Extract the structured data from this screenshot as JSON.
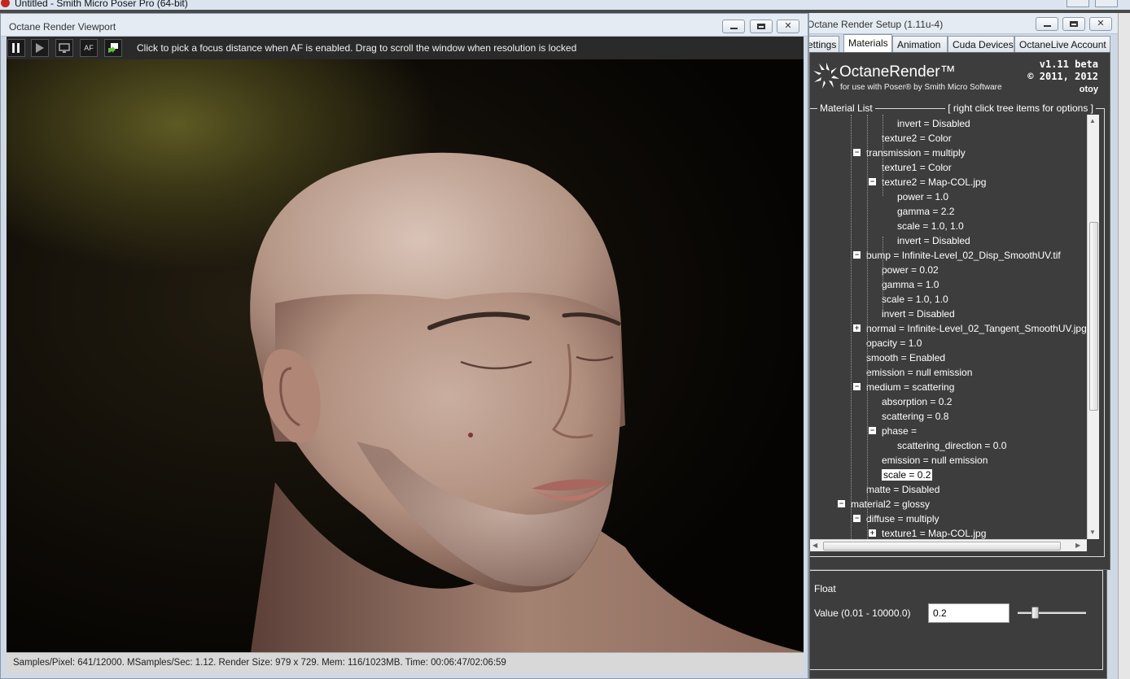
{
  "poser": {
    "title": "Untitled - Smith Micro Poser Pro  (64-bit)"
  },
  "viewport": {
    "title": "Octane Render Viewport",
    "hint": "Click to pick a focus distance when AF is enabled.  Drag to scroll the window when resolution is locked",
    "toolbar": {
      "af_label": "AF"
    },
    "status": "Samples/Pixel: 641/12000. MSamples/Sec: 1.12. Render Size: 979 x 729. Mem: 116/1023MB. Time: 00:06:47/02:06:59"
  },
  "setup": {
    "title": "Octane Render Setup (1.11u-4)",
    "tabs": [
      {
        "label": "ettings",
        "active": false
      },
      {
        "label": "Materials",
        "active": true
      },
      {
        "label": "Animation",
        "active": false
      },
      {
        "label": "Cuda Devices",
        "active": false
      },
      {
        "label": "OctaneLive Account",
        "active": false
      }
    ],
    "brand": {
      "name_bold": "Octane",
      "name_rest": "Render™",
      "subtitle": "for use with Poser® by Smith Micro Software",
      "version": "v1.11 beta",
      "copyright": "© 2011, 2012",
      "otoy": "otoy"
    },
    "material_list": {
      "legend": "Material List",
      "hint": "[ right click tree items for options ]",
      "items": [
        {
          "text": "invert = Disabled",
          "level": 4,
          "expander": ""
        },
        {
          "text": "texture2 = Color",
          "level": 3,
          "expander": ""
        },
        {
          "text": "transmission = multiply",
          "level": 2,
          "expander": "minus"
        },
        {
          "text": "texture1 = Color",
          "level": 3,
          "expander": ""
        },
        {
          "text": "texture2 = Map-COL.jpg",
          "level": 3,
          "expander": "minus"
        },
        {
          "text": "power = 1.0",
          "level": 4,
          "expander": ""
        },
        {
          "text": "gamma = 2.2",
          "level": 4,
          "expander": ""
        },
        {
          "text": "scale = 1.0, 1.0",
          "level": 4,
          "expander": ""
        },
        {
          "text": "invert = Disabled",
          "level": 4,
          "expander": ""
        },
        {
          "text": "bump = Infinite-Level_02_Disp_SmoothUV.tif",
          "level": 2,
          "expander": "minus"
        },
        {
          "text": "power = 0.02",
          "level": 3,
          "expander": ""
        },
        {
          "text": "gamma = 1.0",
          "level": 3,
          "expander": ""
        },
        {
          "text": "scale = 1.0, 1.0",
          "level": 3,
          "expander": ""
        },
        {
          "text": "invert = Disabled",
          "level": 3,
          "expander": ""
        },
        {
          "text": "normal = Infinite-Level_02_Tangent_SmoothUV.jpg",
          "level": 2,
          "expander": "plus"
        },
        {
          "text": "opacity = 1.0",
          "level": 2,
          "expander": ""
        },
        {
          "text": "smooth = Enabled",
          "level": 2,
          "expander": ""
        },
        {
          "text": "emission = null emission",
          "level": 2,
          "expander": ""
        },
        {
          "text": "medium = scattering",
          "level": 2,
          "expander": "minus"
        },
        {
          "text": "absorption = 0.2",
          "level": 3,
          "expander": ""
        },
        {
          "text": "scattering = 0.8",
          "level": 3,
          "expander": ""
        },
        {
          "text": "phase =",
          "level": 3,
          "expander": "minus"
        },
        {
          "text": "scattering_direction = 0.0",
          "level": 4,
          "expander": ""
        },
        {
          "text": "emission = null emission",
          "level": 3,
          "expander": ""
        },
        {
          "text": "scale = 0.2",
          "level": 3,
          "expander": "",
          "selected": true
        },
        {
          "text": "matte = Disabled",
          "level": 2,
          "expander": ""
        },
        {
          "text": "material2 = glossy",
          "level": 1,
          "expander": "minus"
        },
        {
          "text": "diffuse = multiply",
          "level": 2,
          "expander": "minus"
        },
        {
          "text": "texture1 = Map-COL.jpg",
          "level": 3,
          "expander": "plus"
        }
      ]
    },
    "float": {
      "type": "Float",
      "value_label": "Value (0.01 - 10000.0)",
      "value": "0.2",
      "slider_fraction": 0.25
    }
  },
  "colors": {
    "panel_bg": "#3d3d3d",
    "window_chrome": "#cfd9e6"
  }
}
